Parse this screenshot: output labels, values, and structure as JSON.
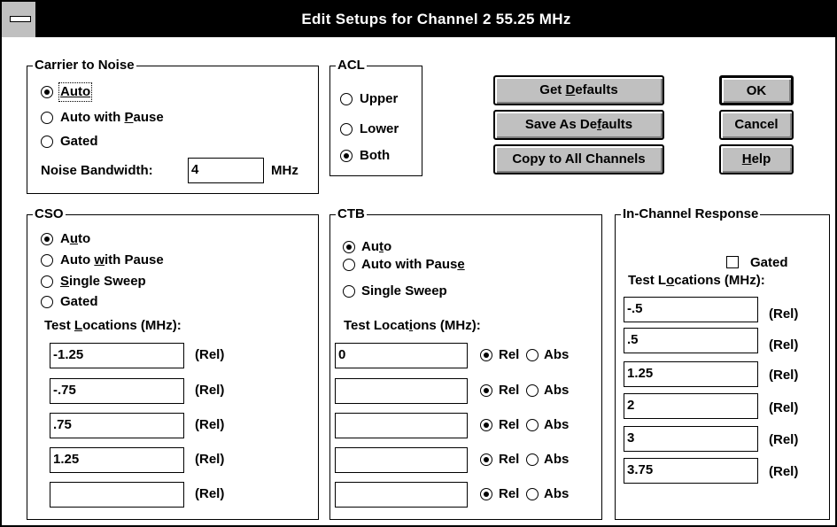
{
  "window": {
    "title": "Edit Setups for Channel 2  55.25 MHz"
  },
  "carrier_to_noise": {
    "legend": "Carrier to Noise",
    "options": [
      "Auto",
      "Auto with Pause",
      "Gated"
    ],
    "selected": "Auto",
    "noise_bandwidth_label": "Noise Bandwidth:",
    "noise_bandwidth_value": "4",
    "unit": "MHz"
  },
  "acl": {
    "legend": "ACL",
    "options": [
      "Upper",
      "Lower",
      "Both"
    ],
    "selected": "Both"
  },
  "buttons": {
    "get_defaults": "Get Defaults",
    "save_as_defaults": "Save As Defaults",
    "copy_to_all": "Copy to All Channels",
    "ok": "OK",
    "cancel": "Cancel",
    "help": "Help"
  },
  "cso": {
    "legend": "CSO",
    "options": [
      "Auto",
      "Auto with Pause",
      "Single Sweep",
      "Gated"
    ],
    "selected": "Auto",
    "test_locations_label": "Test Locations (MHz):",
    "rows": [
      {
        "value": "-1.25",
        "tag": "(Rel)"
      },
      {
        "value": "-.75",
        "tag": "(Rel)"
      },
      {
        "value": ".75",
        "tag": "(Rel)"
      },
      {
        "value": "1.25",
        "tag": "(Rel)"
      },
      {
        "value": "",
        "tag": "(Rel)"
      }
    ]
  },
  "ctb": {
    "legend": "CTB",
    "options": [
      "Auto",
      "Auto with Pause",
      "Single Sweep"
    ],
    "selected": "Auto",
    "test_locations_label": "Test Locations (MHz):",
    "rel_label": "Rel",
    "abs_label": "Abs",
    "rows": [
      {
        "value": "0",
        "mode": "Rel"
      },
      {
        "value": "",
        "mode": "Rel"
      },
      {
        "value": "",
        "mode": "Rel"
      },
      {
        "value": "",
        "mode": "Rel"
      },
      {
        "value": "",
        "mode": "Rel"
      }
    ]
  },
  "in_channel": {
    "legend": "In-Channel Response",
    "gated_label": "Gated",
    "gated_checked": false,
    "test_locations_label": "Test Locations (MHz):",
    "rows": [
      {
        "value": "-.5",
        "tag": "(Rel)"
      },
      {
        "value": ".5",
        "tag": "(Rel)"
      },
      {
        "value": "1.25",
        "tag": "(Rel)"
      },
      {
        "value": "2",
        "tag": "(Rel)"
      },
      {
        "value": "3",
        "tag": "(Rel)"
      },
      {
        "value": "3.75",
        "tag": "(Rel)"
      }
    ]
  }
}
